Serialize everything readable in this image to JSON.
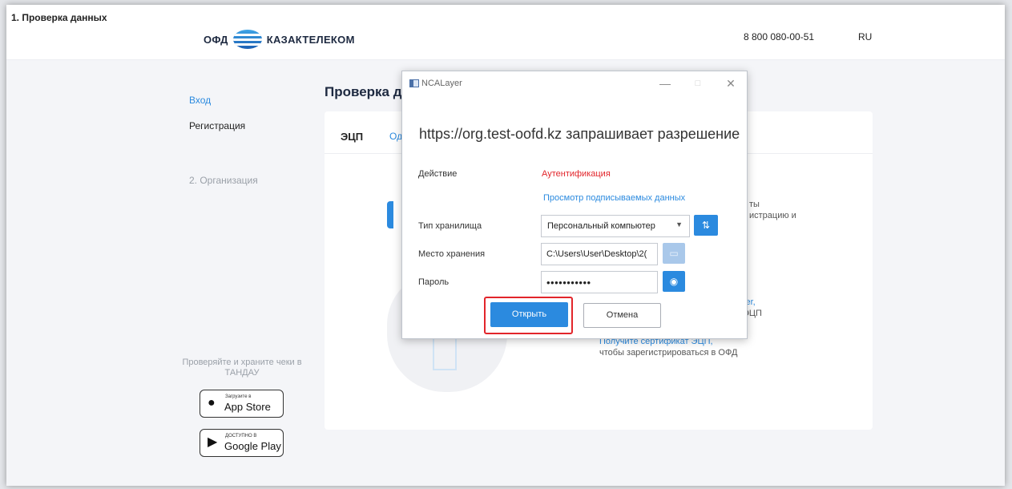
{
  "header": {
    "logo_left": "ОФД",
    "logo_right": "КАЗАКТЕЛЕКОМ",
    "phone": "8 800 080-00-51",
    "language": "RU"
  },
  "sidebar": {
    "items": [
      {
        "label": "Вход",
        "state": "link"
      },
      {
        "label": "Регистрация",
        "state": "normal"
      },
      {
        "label": "1. Проверка данных",
        "state": "active"
      },
      {
        "label": "2. Организация",
        "state": "disabled"
      }
    ],
    "promo": "Проверяйте и храните чеки в ТАНДАУ",
    "appstore": {
      "small": "Загрузите в",
      "big": "App Store",
      "icon": "apple-icon"
    },
    "googleplay": {
      "small": "ДОСТУПНО В",
      "big": "Google Play",
      "icon": "play-icon"
    }
  },
  "main": {
    "title": "Проверка д",
    "tabs": [
      "ЭЦП",
      "Од"
    ],
    "fragments": {
      "t1": "ты",
      "t2": "истрацию и",
      "t3": "yer,",
      "t4": "ЭЦП",
      "t5": "Получите сертификат ЭЦП,",
      "t6": "чтобы зарегистрироваться в ОФД"
    }
  },
  "dialog": {
    "title": "NCALayer",
    "request": "https://org.test-oofd.kz запрашивает разрешение",
    "labels": {
      "action": "Действие",
      "storage_type": "Тип хранилища",
      "location": "Место хранения",
      "password": "Пароль"
    },
    "action_value": "Аутентификация",
    "view_data_link": "Просмотр подписываемых данных",
    "storage_type_value": "Персональный компьютер",
    "location_value": "C:\\Users\\User\\Desktop\\2(",
    "password_value": "•••••••••••",
    "open_button": "Открыть",
    "cancel_button": "Отмена",
    "colors": {
      "accent": "#2b8adf",
      "highlight": "#e2252b",
      "action": "#e2252b"
    }
  }
}
